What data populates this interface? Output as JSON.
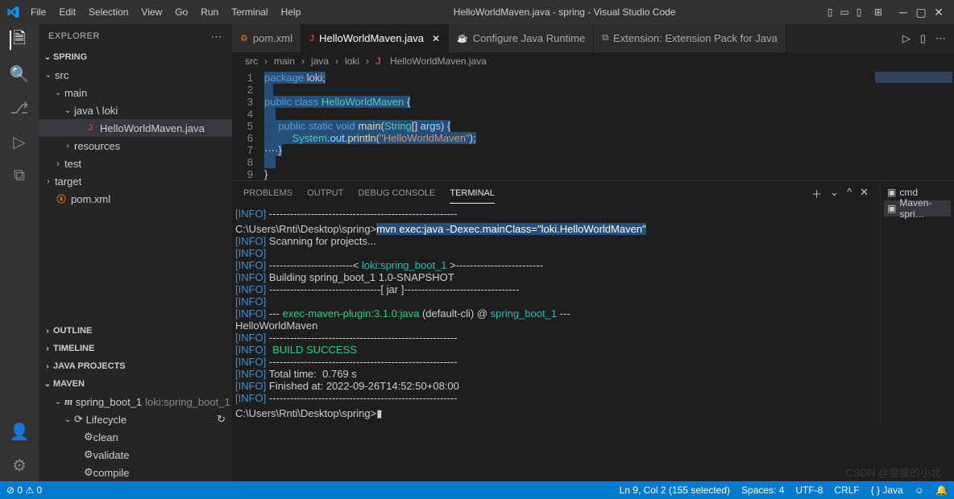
{
  "title": "HelloWorldMaven.java - spring - Visual Studio Code",
  "menu": [
    "File",
    "Edit",
    "Selection",
    "View",
    "Go",
    "Run",
    "Terminal",
    "Help"
  ],
  "explorer": {
    "header": "EXPLORER",
    "project": "SPRING",
    "tree": {
      "src": "src",
      "main": "main",
      "pkg": "java \\ loki",
      "file": "HelloWorldMaven.java",
      "resources": "resources",
      "test": "test",
      "target": "target",
      "pom": "pom.xml"
    },
    "sections": {
      "outline": "OUTLINE",
      "timeline": "TIMELINE",
      "javaProjects": "JAVA PROJECTS",
      "maven": "MAVEN"
    },
    "maven": {
      "module": "spring_boot_1",
      "moduleId": "loki:spring_boot_1",
      "lifecycle": "Lifecycle",
      "goals": [
        "clean",
        "validate",
        "compile"
      ]
    }
  },
  "tabs": [
    {
      "icon": "⚙",
      "label": "pom.xml"
    },
    {
      "icon": "J",
      "label": "HelloWorldMaven.java",
      "active": true,
      "closable": true
    },
    {
      "icon": "☕",
      "label": "Configure Java Runtime"
    },
    {
      "icon": "⧉",
      "label": "Extension: Extension Pack for Java"
    }
  ],
  "breadcrumb": [
    "src",
    "main",
    "java",
    "loki",
    "HelloWorldMaven.java"
  ],
  "code": {
    "lines": 9,
    "l1a": "package",
    "l1b": " loki;",
    "l3a": "public",
    "l3b": "class",
    "l3c": "HelloWorldMaven",
    "l3d": "{",
    "l5a": "····",
    "l5b": "public",
    "l5c": "static",
    "l5d": "void",
    "l5e": "main",
    "l5f": "(",
    "l5g": "String",
    "l5h": "[] ",
    "l5i": "args",
    "l5j": ") {",
    "l6a": "········",
    "l6b": "System",
    "l6c": ".",
    "l6d": "out",
    "l6e": ".",
    "l6f": "println",
    "l6g": "(",
    "l6h": "\"HelloWorldMaven\"",
    "l6i": ");",
    "l7": "····}",
    "l9": "}"
  },
  "panel": {
    "tabs": {
      "problems": "PROBLEMS",
      "output": "OUTPUT",
      "debug": "DEBUG CONSOLE",
      "terminal": "TERMINAL"
    },
    "terminalSide": {
      "cmd": "cmd",
      "maven": "Maven-spri…"
    },
    "term": {
      "info": "[INFO]",
      "dashes": " ------------------------------------------------------",
      "prompt": "C:\\Users\\Rnti\\Desktop\\spring>",
      "cmd": "mvn exec:java -Dexec.mainClass=\"loki.HelloWorldMaven\"",
      "scan": " Scanning for projects...",
      "modPre": " ------------------------< ",
      "mod": "loki:spring_boot_1",
      "modPost": " >-------------------------",
      "build": " Building spring_boot_1 1.0-SNAPSHOT",
      "jar": " --------------------------------[ jar ]---------------------------------",
      "pluginPre": " --- ",
      "plugin": "exec-maven-plugin:3.1.0:java",
      "pluginMid": " (default-cli) @ ",
      "pluginProj": "spring_boot_1",
      "pluginPost": " ---",
      "output": "HelloWorldMaven",
      "success": "BUILD SUCCESS",
      "time": " Total time:  0.769 s",
      "finished": " Finished at: 2022-09-26T14:52:50+08:00",
      "cursor": "▮"
    }
  },
  "status": {
    "left": {
      "remote": "⊘",
      "err": "0",
      "warn": "0"
    },
    "right": {
      "pos": "Ln 9, Col 2 (155 selected)",
      "spaces": "Spaces: 4",
      "enc": "UTF-8",
      "eol": "CRLF",
      "lang": "Java",
      "bell": "🔔"
    }
  },
  "watermark": "CSDN @瘦瘦的小北"
}
